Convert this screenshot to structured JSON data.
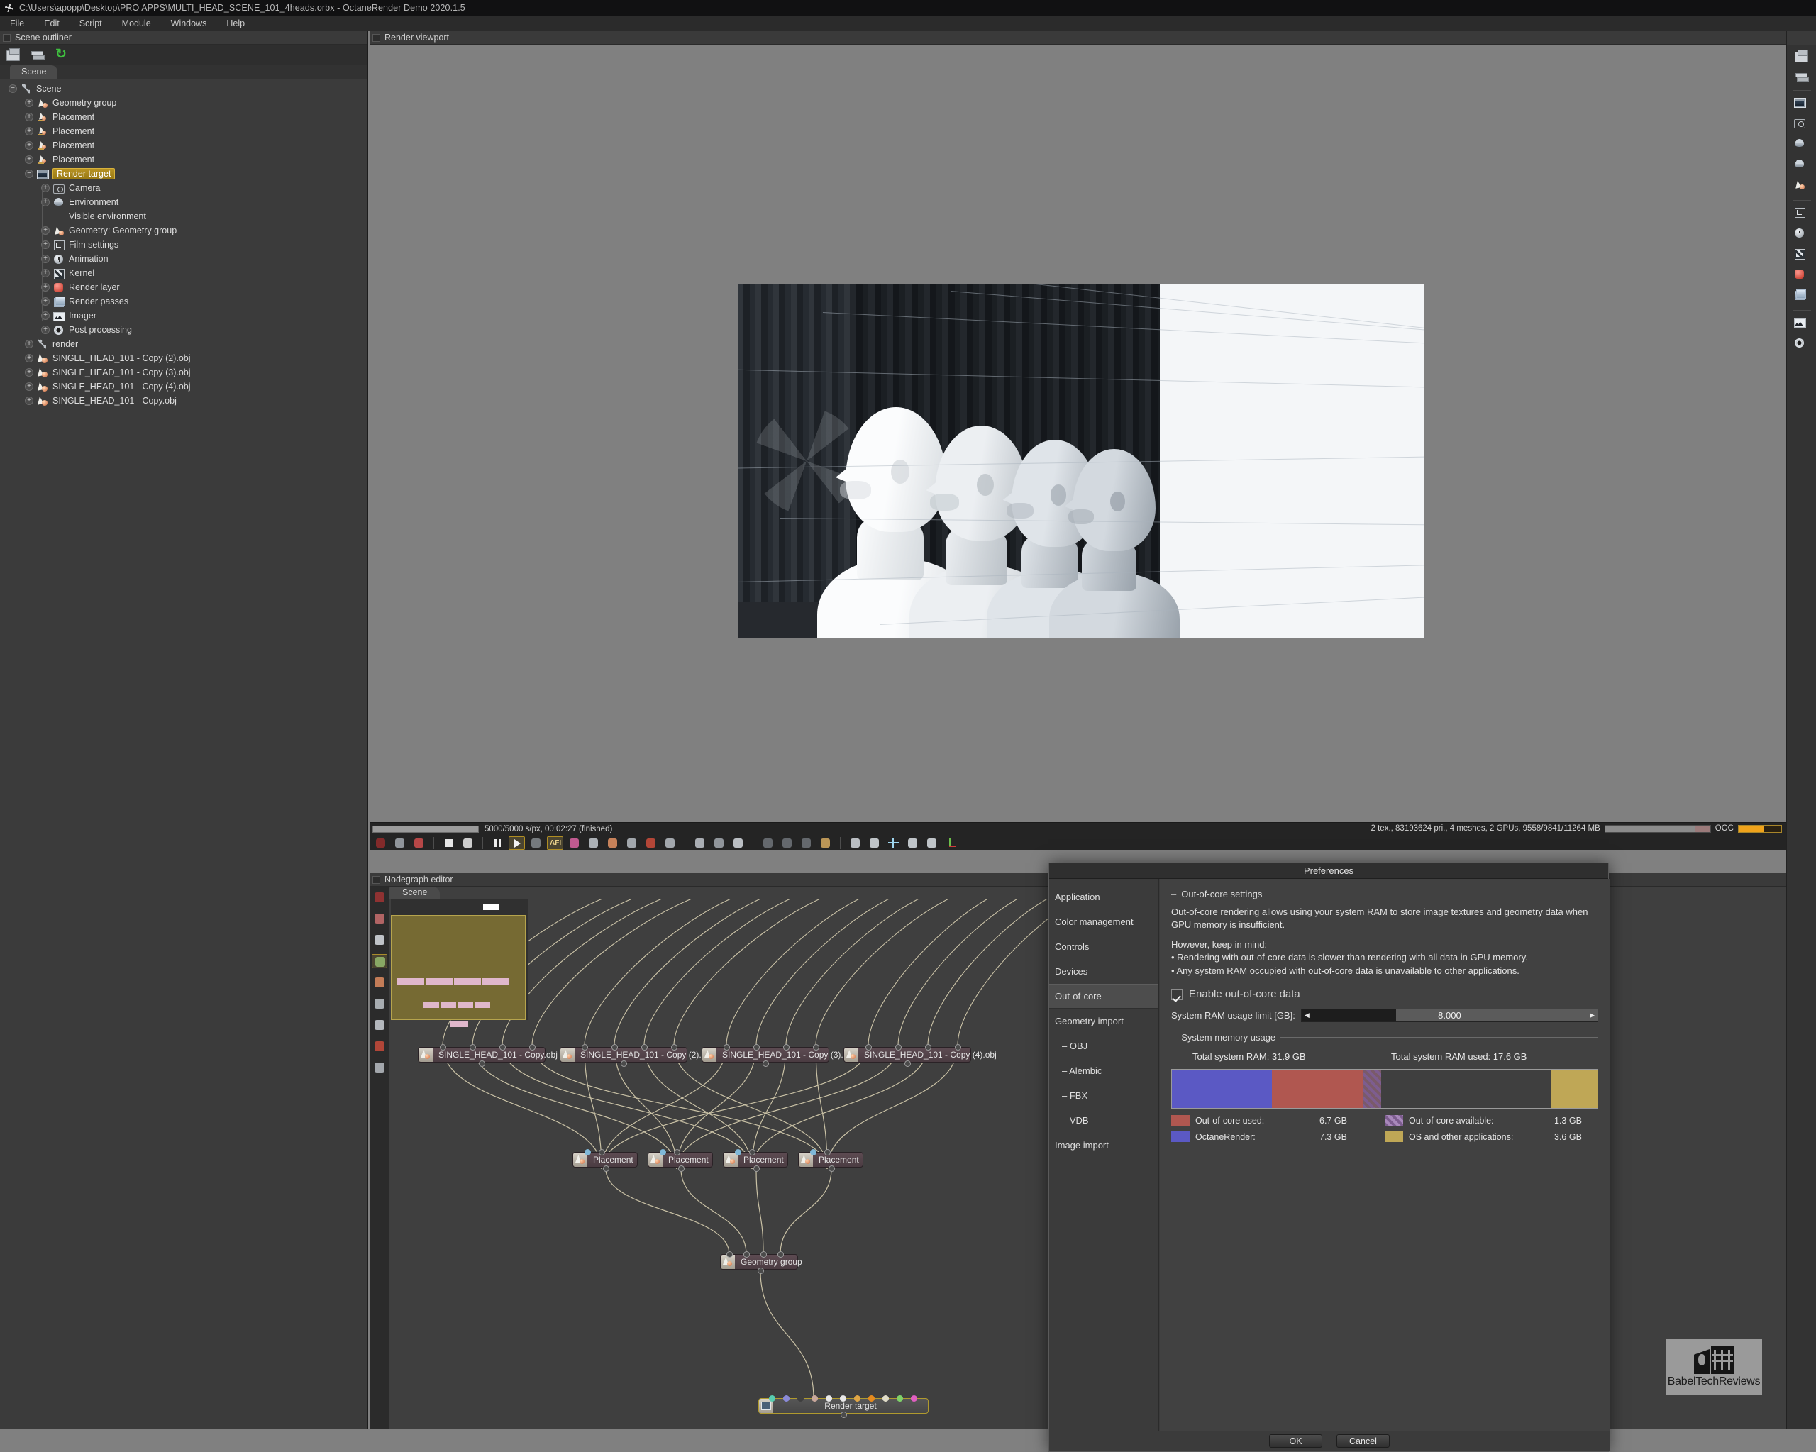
{
  "titlebar": {
    "icon": "octane-logo-icon",
    "text": "C:\\Users\\apopp\\Desktop\\PRO APPS\\MULTI_HEAD_SCENE_101_4heads.orbx - OctaneRender Demo 2020.1.5"
  },
  "menubar": {
    "items": [
      "File",
      "Edit",
      "Script",
      "Module",
      "Windows",
      "Help"
    ]
  },
  "outliner": {
    "header": "Scene outliner",
    "toolbar": [
      "save-icon",
      "stack-icon",
      "reload-icon"
    ],
    "tab": "Scene",
    "tree": [
      {
        "label": "Scene",
        "indent": 0,
        "expander": "minus",
        "icon": "scene-icon",
        "selected": false
      },
      {
        "label": "Geometry group",
        "indent": 1,
        "expander": "plus",
        "icon": "geometry-icon",
        "selected": false
      },
      {
        "label": "Placement",
        "indent": 1,
        "expander": "plus",
        "icon": "placement-icon",
        "selected": false
      },
      {
        "label": "Placement",
        "indent": 1,
        "expander": "plus",
        "icon": "placement-icon",
        "selected": false
      },
      {
        "label": "Placement",
        "indent": 1,
        "expander": "plus",
        "icon": "placement-icon",
        "selected": false
      },
      {
        "label": "Placement",
        "indent": 1,
        "expander": "plus",
        "icon": "placement-icon",
        "selected": false
      },
      {
        "label": "Render target",
        "indent": 1,
        "expander": "minus",
        "icon": "render-target-icon",
        "selected": true
      },
      {
        "label": "Camera",
        "indent": 2,
        "expander": "plus",
        "icon": "camera-icon",
        "selected": false
      },
      {
        "label": "Environment",
        "indent": 2,
        "expander": "plus",
        "icon": "environment-icon",
        "selected": false
      },
      {
        "label": "Visible environment",
        "indent": 2,
        "expander": "none",
        "icon": "none",
        "selected": false
      },
      {
        "label": "Geometry: Geometry group",
        "indent": 2,
        "expander": "plus",
        "icon": "geometry-icon",
        "selected": false
      },
      {
        "label": "Film settings",
        "indent": 2,
        "expander": "plus",
        "icon": "film-settings-icon",
        "selected": false
      },
      {
        "label": "Animation",
        "indent": 2,
        "expander": "plus",
        "icon": "animation-icon",
        "selected": false
      },
      {
        "label": "Kernel",
        "indent": 2,
        "expander": "plus",
        "icon": "kernel-icon",
        "selected": false
      },
      {
        "label": "Render layer",
        "indent": 2,
        "expander": "plus",
        "icon": "render-layer-icon",
        "selected": false
      },
      {
        "label": "Render passes",
        "indent": 2,
        "expander": "plus",
        "icon": "render-passes-icon",
        "selected": false
      },
      {
        "label": "Imager",
        "indent": 2,
        "expander": "plus",
        "icon": "imager-icon",
        "selected": false
      },
      {
        "label": "Post processing",
        "indent": 2,
        "expander": "plus",
        "icon": "post-processing-icon",
        "selected": false
      },
      {
        "label": "render",
        "indent": 1,
        "expander": "plus",
        "icon": "scene-icon",
        "selected": false
      },
      {
        "label": "SINGLE_HEAD_101 - Copy (2).obj",
        "indent": 1,
        "expander": "plus",
        "icon": "obj-icon",
        "selected": false
      },
      {
        "label": "SINGLE_HEAD_101 - Copy (3).obj",
        "indent": 1,
        "expander": "plus",
        "icon": "obj-icon",
        "selected": false
      },
      {
        "label": "SINGLE_HEAD_101 - Copy (4).obj",
        "indent": 1,
        "expander": "plus",
        "icon": "obj-icon",
        "selected": false
      },
      {
        "label": "SINGLE_HEAD_101 - Copy.obj",
        "indent": 1,
        "expander": "plus",
        "icon": "obj-icon",
        "selected": false
      }
    ]
  },
  "viewport": {
    "header": "Render viewport",
    "status_left": "5000/5000 s/px, 00:02:27 (finished)",
    "status_right": "2 tex., 83193624 pri., 4 meshes, 2 GPUs, 9558/9841/11264 MB",
    "ooc_label": "OOC",
    "toolbar": [
      "octane-icon",
      "fit-icon",
      "color-picker-icon",
      "sep",
      "stop-icon",
      "restart-icon",
      "sep",
      "pause-icon",
      "play-icon",
      "screen-icon",
      "afi-icon",
      "color-wheel-icon",
      "material-sphere-icon",
      "geometry-pick-icon",
      "camera-pick-icon",
      "image-pick-icon",
      "layer-pick-icon",
      "sep",
      "zoom-icon",
      "region-icon",
      "speed-icon",
      "sep",
      "clipboard-icon",
      "save-render-icon",
      "ghost-icon",
      "checker-icon",
      "sep",
      "lock-icon",
      "cube-icon",
      "move-icon",
      "rotate-icon",
      "scale-icon",
      "axis-icon"
    ]
  },
  "nodegraph": {
    "header": "Nodegraph editor",
    "tab": "Scene",
    "tools": [
      "octane-node-icon",
      "select-icon",
      "group-icon",
      "graph-icon",
      "material-icon",
      "sphere-icon",
      "texture-icon",
      "histogram-icon",
      "grid-icon"
    ],
    "obj_nodes": [
      "SINGLE_HEAD_101 - Copy.obj",
      "SINGLE_HEAD_101 - Copy (2).obj",
      "SINGLE_HEAD_101 - Copy (3).obj",
      "SINGLE_HEAD_101 - Copy (4).obj"
    ],
    "placement_nodes": [
      "Placement",
      "Placement",
      "Placement",
      "Placement"
    ],
    "geometry_group_node": "Geometry group",
    "render_target_node": "Render target"
  },
  "prefs": {
    "title": "Preferences",
    "sidebar": [
      {
        "label": "Application",
        "sub": false,
        "active": false
      },
      {
        "label": "Color management",
        "sub": false,
        "active": false
      },
      {
        "label": "Controls",
        "sub": false,
        "active": false
      },
      {
        "label": "Devices",
        "sub": false,
        "active": false
      },
      {
        "label": "Out-of-core",
        "sub": false,
        "active": true
      },
      {
        "label": "Geometry import",
        "sub": false,
        "active": false
      },
      {
        "label": "OBJ",
        "sub": true,
        "active": false
      },
      {
        "label": "Alembic",
        "sub": true,
        "active": false
      },
      {
        "label": "FBX",
        "sub": true,
        "active": false
      },
      {
        "label": "VDB",
        "sub": true,
        "active": false
      },
      {
        "label": "Image import",
        "sub": false,
        "active": false
      }
    ],
    "settings_legend": "Out-of-core settings",
    "intro": "Out-of-core rendering allows using your system RAM to store image textures and geometry data when GPU memory is insufficient.",
    "keep_in_mind": "However, keep in mind:",
    "bullets": [
      "• Rendering with out-of-core data is slower than rendering with all data in GPU memory.",
      "• Any system RAM occupied with out-of-core data is unavailable to other applications."
    ],
    "checkbox_label": "Enable out-of-core data",
    "checkbox_checked": true,
    "slider_label": "System RAM usage limit [GB]:",
    "slider_value": "8.000",
    "memory_legend": "System memory usage",
    "total_ram": "Total system RAM: 31.9 GB",
    "total_used": "Total system RAM used: 17.6 GB",
    "legend_entries": [
      {
        "name": "Out-of-core used:",
        "value": "6.7 GB",
        "color": "#b05750",
        "hatched": false
      },
      {
        "name": "Out-of-core available:",
        "value": "1.3 GB",
        "color": "#7d5d8f",
        "hatched": true
      },
      {
        "name": "OctaneRender:",
        "value": "7.3 GB",
        "color": "#5b59c4",
        "hatched": false
      },
      {
        "name": "OS and other applications:",
        "value": "3.6 GB",
        "color": "#bfa756",
        "hatched": false
      }
    ],
    "bar_segments": [
      {
        "name": "OctaneRender",
        "color": "#5b59c4",
        "width_pct": 23.5
      },
      {
        "name": "Out-of-core used",
        "color": "#b05750",
        "width_pct": 21.5
      },
      {
        "name": "Out-of-core available",
        "color": "#7d5d8f",
        "width_pct": 4.2,
        "hatched": true
      },
      {
        "name": "Free",
        "color": "#3f3f3f",
        "width_pct": 39.8
      },
      {
        "name": "OS and other applications",
        "color": "#bfa756",
        "width_pct": 11.0
      }
    ],
    "ok": "OK",
    "cancel": "Cancel"
  },
  "watermark": {
    "text": "BabelTechReviews",
    "mark": "building-icon"
  }
}
